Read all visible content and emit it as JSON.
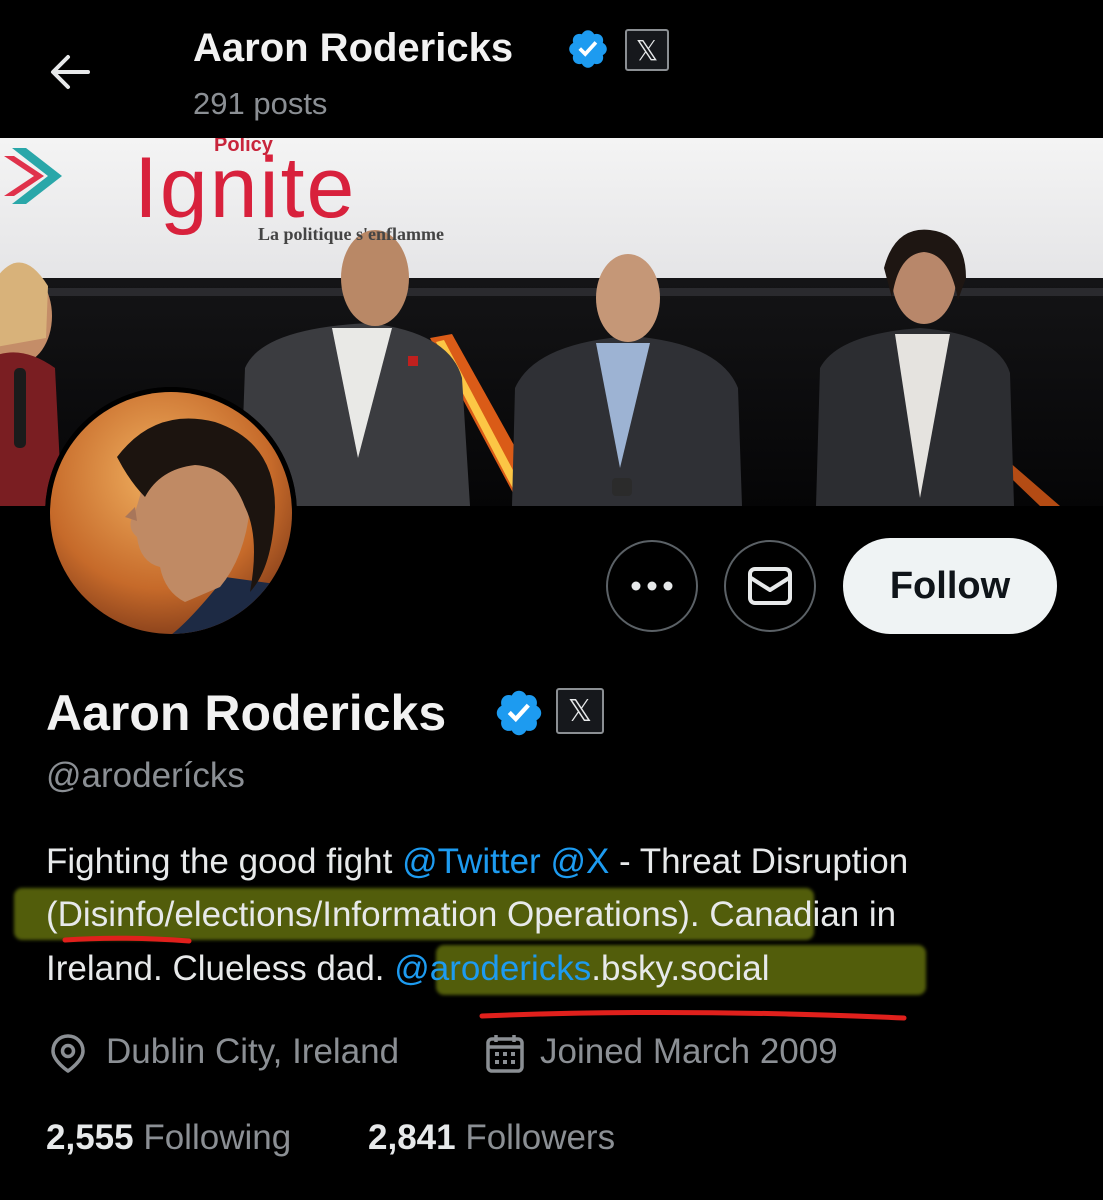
{
  "header": {
    "title": "Aaron Rodericks",
    "posts_count": "291 posts",
    "x_badge": "𝕏"
  },
  "banner": {
    "sign_small": "Policy",
    "sign_main": "Ignite",
    "sign_tagline": "La politique s'enflamme"
  },
  "actions": {
    "follow_label": "Follow"
  },
  "profile": {
    "name": "Aaron Rodericks",
    "x_badge": "𝕏",
    "handle": "@aroderícks"
  },
  "bio": {
    "line1_pre": "Fighting the good fight ",
    "mention_twitter": "@Twitter",
    "mention_x": "@X",
    "line1_post": " - Threat Disruption",
    "line2": "(Disinfo/elections/Information Operations). Canadian in",
    "line3_pre": "Ireland. Clueless dad. ",
    "mention_bsky": "@arodericks",
    "line3_post": ".bsky.social"
  },
  "meta": {
    "location": "Dublin City, Ireland",
    "joined": "Joined March 2009"
  },
  "stats": {
    "following_count": "2,555",
    "following_label": "Following",
    "followers_count": "2,841",
    "followers_label": "Followers"
  },
  "colors": {
    "background": "#000000",
    "link": "#1d9bf0",
    "verified": "#1d9bf0",
    "muted_text": "#8b8f94",
    "highlight": "#96aa14",
    "underline": "#e0201c"
  }
}
